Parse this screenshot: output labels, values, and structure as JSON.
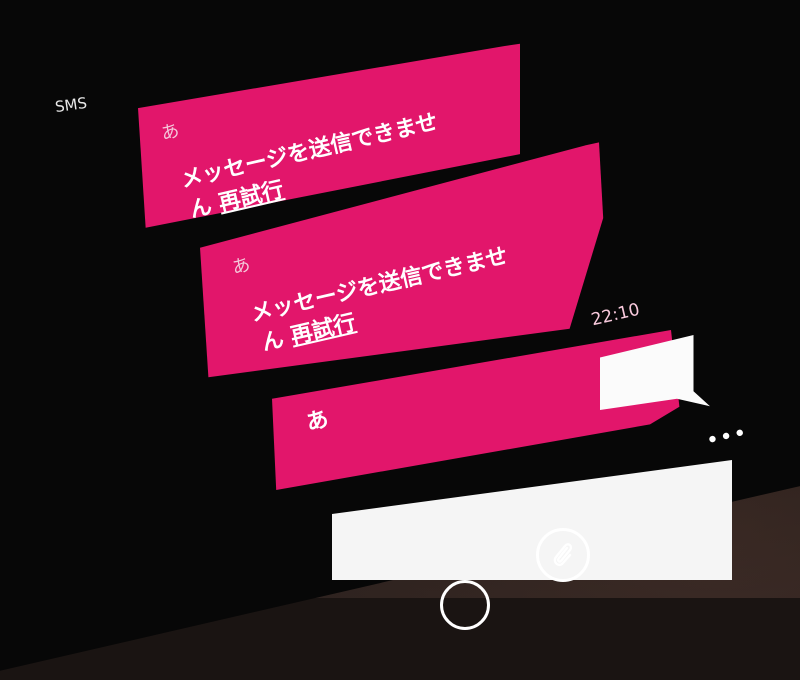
{
  "app": {
    "title": "SMS"
  },
  "thread": {
    "messages": [
      {
        "sender": "あ",
        "text_line1": "メッセージを送信できませ",
        "text_line2": "ん",
        "retry": "再試行"
      },
      {
        "sender": "あ",
        "text_line1": "メッセージを送信できませ",
        "text_line2": "ん",
        "retry": "再試行",
        "time": "22:10"
      },
      {
        "sender": "あ"
      }
    ]
  },
  "compose": {
    "value": ""
  },
  "app_bar": {
    "more": "•••",
    "buttons": [
      "attach-icon",
      "bottom-icon"
    ]
  },
  "colors": {
    "accent": "#e2166b",
    "background": "#070707",
    "text": "#ffffff"
  }
}
